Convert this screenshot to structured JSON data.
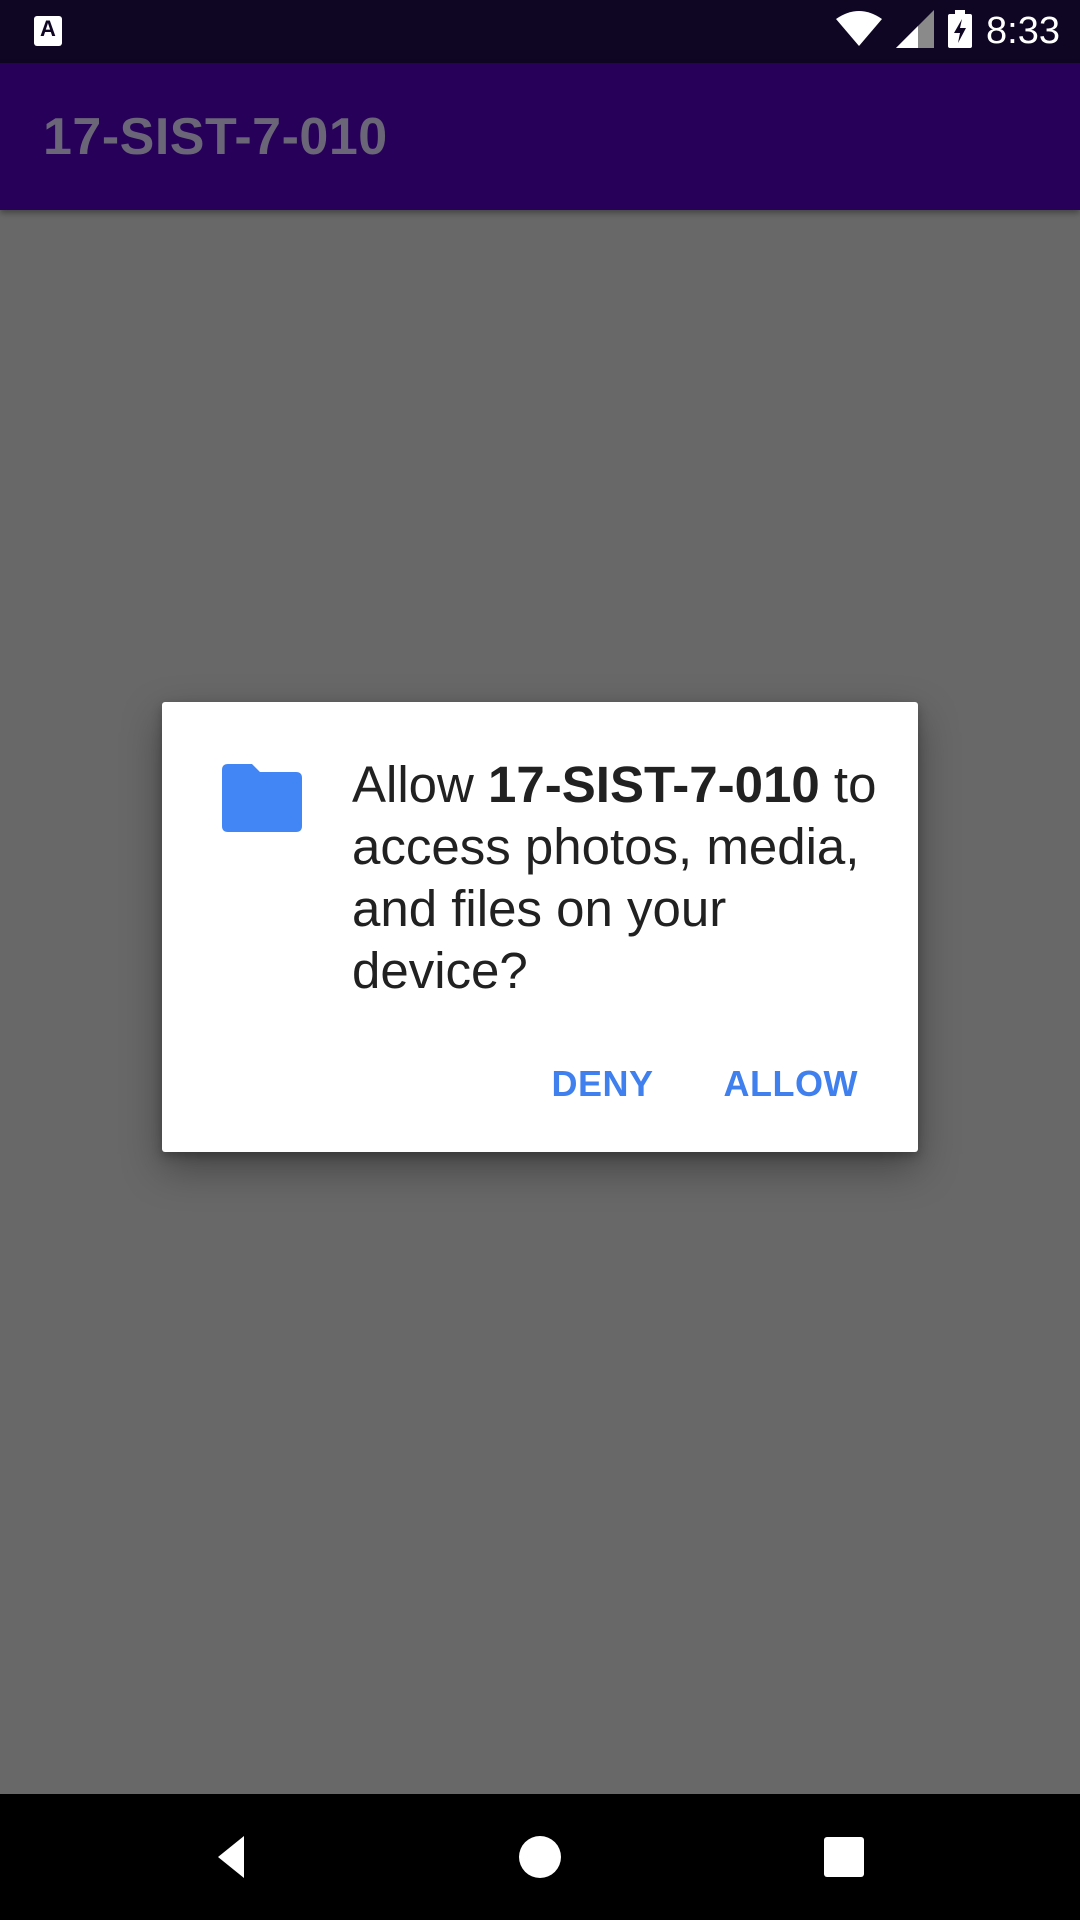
{
  "status_bar": {
    "notification_icon": "A",
    "time": "8:33",
    "icons": [
      "wifi-icon",
      "cell-signal-icon",
      "battery-charging-icon"
    ]
  },
  "app_bar": {
    "title": "17-SIST-7-010"
  },
  "dialog": {
    "icon": "folder-icon",
    "message_prefix": "Allow ",
    "app_name": "17-SIST-7-010",
    "message_suffix": " to access photos, media, and files on your device?",
    "deny_label": "DENY",
    "allow_label": "ALLOW"
  },
  "colors": {
    "status_bar": "#0f0623",
    "app_bar": "#27005a",
    "scrim_background": "#686868",
    "accent": "#3f80ee"
  },
  "nav_bar": {
    "buttons": [
      "back-icon",
      "home-icon",
      "recents-icon"
    ]
  }
}
